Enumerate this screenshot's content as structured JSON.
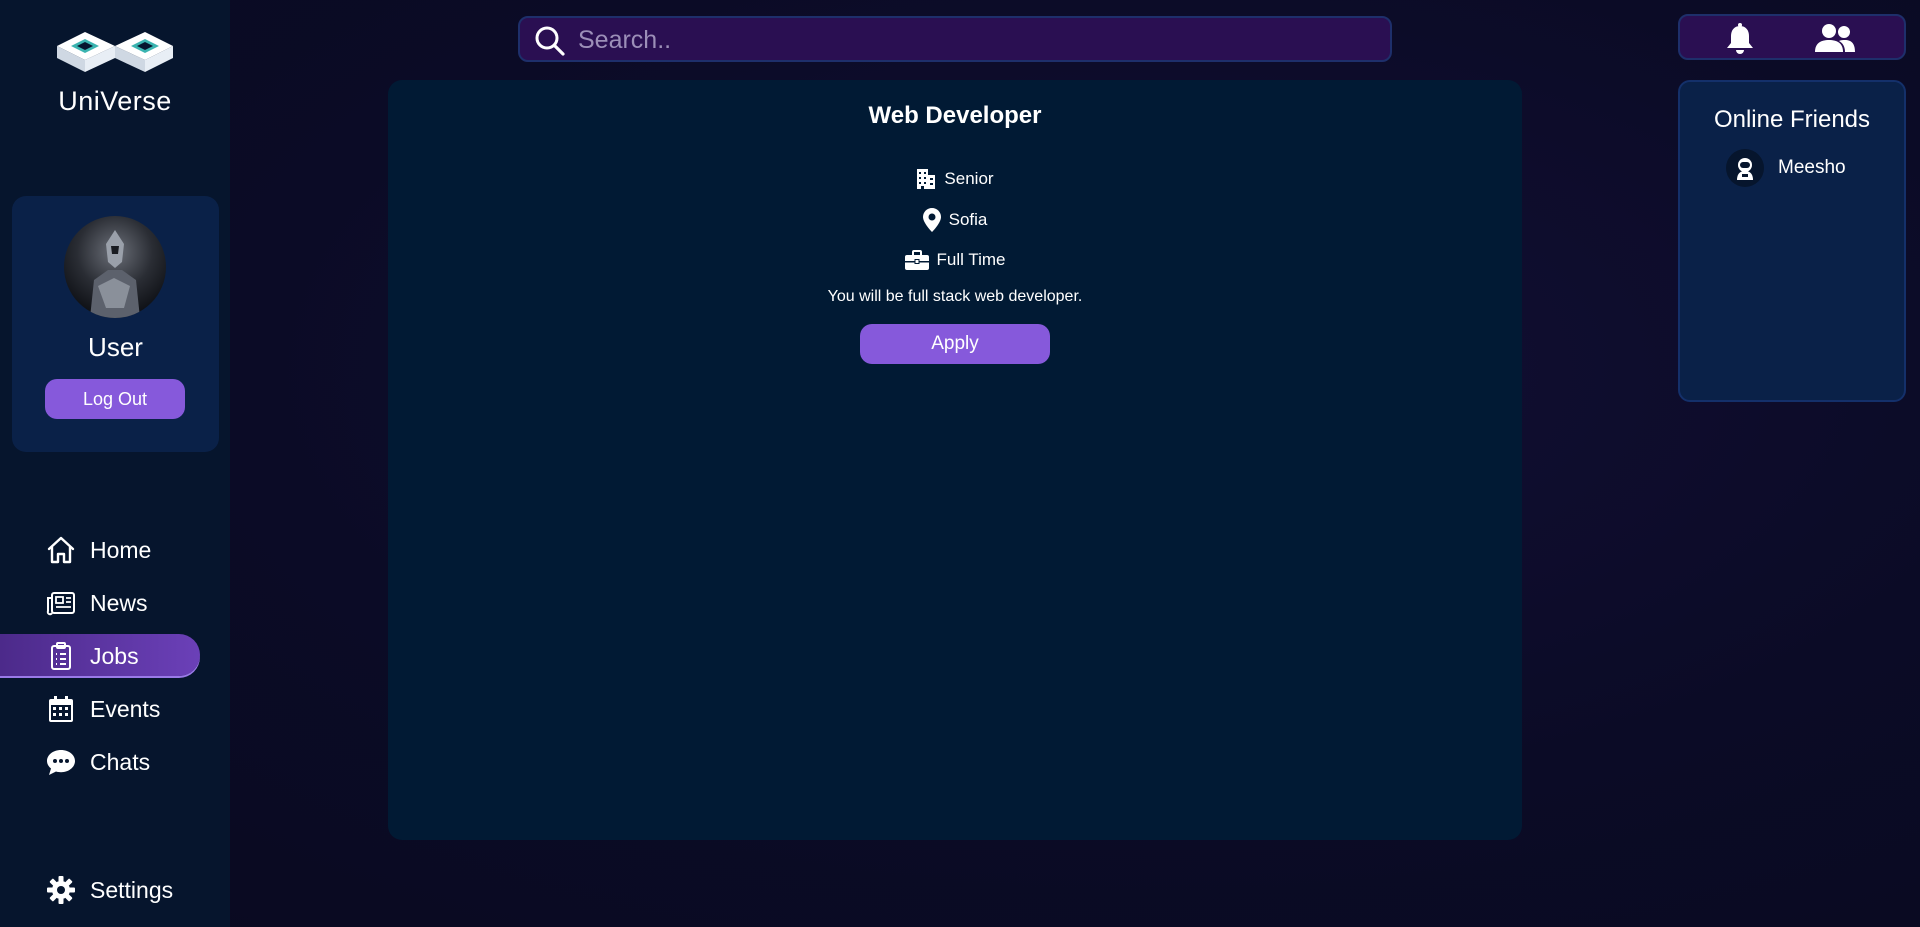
{
  "app": {
    "name": "UniVerse"
  },
  "profile": {
    "name": "User",
    "logout_label": "Log Out"
  },
  "nav": {
    "items": [
      {
        "label": "Home",
        "icon": "home-icon"
      },
      {
        "label": "News",
        "icon": "newspaper-icon"
      },
      {
        "label": "Jobs",
        "icon": "clipboard-icon",
        "active": true
      },
      {
        "label": "Events",
        "icon": "calendar-icon"
      },
      {
        "label": "Chats",
        "icon": "chat-icon"
      }
    ],
    "settings_label": "Settings"
  },
  "search": {
    "placeholder": "Search..",
    "value": ""
  },
  "job": {
    "title": "Web Developer",
    "level": "Senior",
    "location": "Sofia",
    "type": "Full Time",
    "description": "You will be full stack web developer.",
    "apply_label": "Apply"
  },
  "friends": {
    "title": "Online Friends",
    "list": [
      {
        "name": "Meesho"
      }
    ]
  },
  "colors": {
    "accent": "#8659db",
    "sidebar": "#06152d",
    "card": "#011a34",
    "panel": "#0a2148",
    "search_bg": "#2a0f52"
  }
}
